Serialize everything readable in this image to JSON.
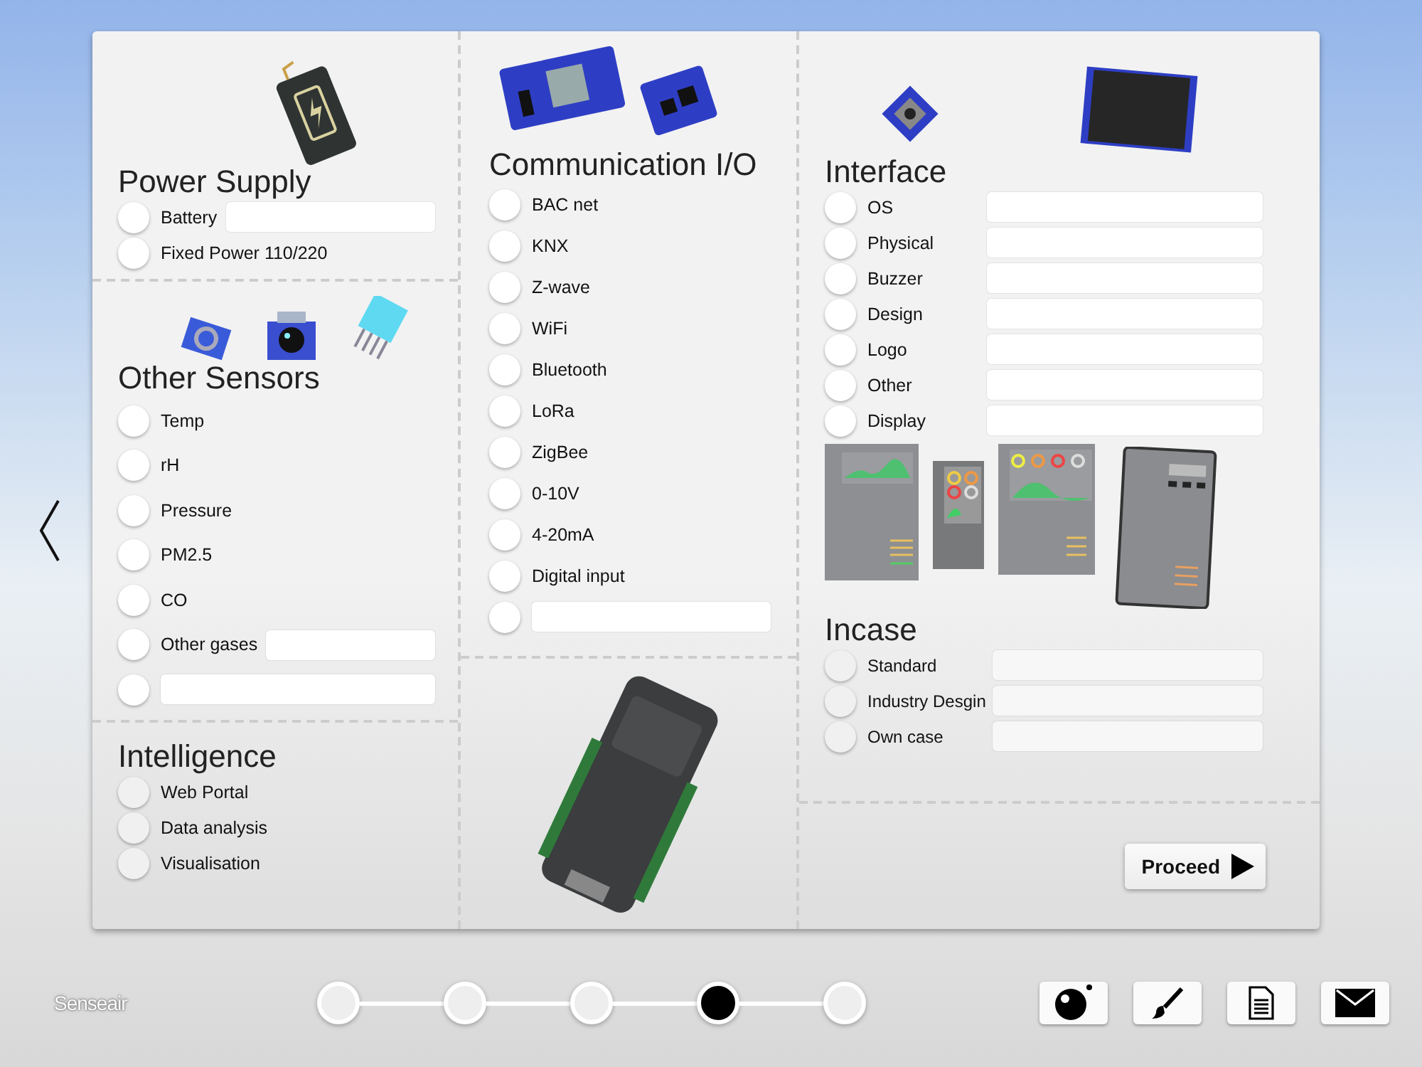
{
  "columns": [
    {
      "sections": [
        {
          "title": "Power Supply",
          "options": [
            {
              "kind": "with-field",
              "label": "Battery",
              "selected": false
            },
            {
              "kind": "plain",
              "label": "Fixed Power 110/220",
              "selected": false
            }
          ]
        },
        {
          "title": "Other Sensors",
          "options": [
            {
              "kind": "plain",
              "label": "Temp",
              "selected": false
            },
            {
              "kind": "plain",
              "label": "rH",
              "selected": false
            },
            {
              "kind": "plain",
              "label": "Pressure",
              "selected": false
            },
            {
              "kind": "plain",
              "label": "PM2.5",
              "selected": false
            },
            {
              "kind": "plain",
              "label": "CO",
              "selected": false
            },
            {
              "kind": "with-field",
              "label": "Other gases",
              "selected": false
            },
            {
              "kind": "field-only",
              "selected": false
            }
          ]
        },
        {
          "title": "Intelligence",
          "options": [
            {
              "kind": "plain",
              "label": "Web Portal",
              "selected": false
            },
            {
              "kind": "plain",
              "label": "Data analysis",
              "selected": false
            },
            {
              "kind": "plain",
              "label": "Visualisation",
              "selected": false
            }
          ]
        }
      ]
    },
    {
      "sections": [
        {
          "title": "Communication I/O",
          "options": [
            {
              "kind": "plain",
              "label": "BAC net",
              "selected": false
            },
            {
              "kind": "plain",
              "label": "KNX",
              "selected": false
            },
            {
              "kind": "plain",
              "label": "Z-wave",
              "selected": false
            },
            {
              "kind": "plain",
              "label": "WiFi",
              "selected": false
            },
            {
              "kind": "plain",
              "label": "Bluetooth",
              "selected": false
            },
            {
              "kind": "plain",
              "label": "LoRa",
              "selected": false
            },
            {
              "kind": "plain",
              "label": "ZigBee",
              "selected": false
            },
            {
              "kind": "plain",
              "label": "0-10V",
              "selected": false
            },
            {
              "kind": "plain",
              "label": "4-20mA",
              "selected": false
            },
            {
              "kind": "plain",
              "label": "Digital input",
              "selected": false
            },
            {
              "kind": "field-only",
              "selected": false
            }
          ]
        }
      ]
    },
    {
      "sections": [
        {
          "title": "Interface",
          "options": [
            {
              "kind": "with-field",
              "label": "OS",
              "selected": false
            },
            {
              "kind": "with-field",
              "label": "Physical",
              "selected": false
            },
            {
              "kind": "with-field",
              "label": "Buzzer",
              "selected": false
            },
            {
              "kind": "with-field",
              "label": "Design",
              "selected": false
            },
            {
              "kind": "with-field",
              "label": "Logo",
              "selected": false
            },
            {
              "kind": "with-field",
              "label": "Other",
              "selected": false
            },
            {
              "kind": "with-field",
              "label": "Display",
              "selected": false
            }
          ]
        },
        {
          "title": "Incase",
          "options": [
            {
              "kind": "with-field",
              "label": "Standard",
              "selected": false
            },
            {
              "kind": "with-field",
              "label": "Industry Desgin",
              "selected": false
            },
            {
              "kind": "with-field",
              "label": "Own case",
              "selected": false
            }
          ]
        }
      ]
    }
  ],
  "proceed": {
    "label": "Proceed"
  },
  "logo": "Senseair",
  "steps": [
    {
      "selected": false
    },
    {
      "selected": false
    },
    {
      "selected": false
    },
    {
      "selected": true
    },
    {
      "selected": false
    }
  ]
}
